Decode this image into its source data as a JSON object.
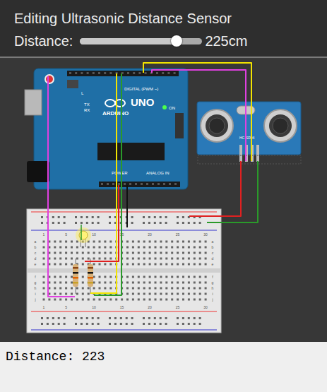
{
  "header": {
    "title": "Editing Ultrasonic Distance Sensor",
    "slider": {
      "label": "Distance:",
      "level": 0.79,
      "reading": "225cm"
    }
  },
  "circuit": {
    "arduino": {
      "brand": "ARDUINO",
      "model": "UNO",
      "digital_label": "DIGITAL (PWM ~)",
      "power_label": "POWER",
      "analog_label": "ANALOG IN",
      "on_label": "ON",
      "tx_label": "TX",
      "rx_label": "RX",
      "l_label": "L"
    },
    "sensor": {
      "label": "HC-SR04"
    },
    "led": {
      "on": true
    },
    "breadboard": {
      "columns": [
        "1",
        "5",
        "10",
        "15",
        "20",
        "25",
        "30"
      ],
      "rows_top": [
        "a",
        "b",
        "c",
        "d",
        "e"
      ],
      "rows_bottom": [
        "f",
        "g",
        "h",
        "i",
        "j"
      ]
    },
    "wires": [
      {
        "name": "trig",
        "color": "#f2e400"
      },
      {
        "name": "echo",
        "color": "#e040e0"
      },
      {
        "name": "sensor-gnd",
        "color": "#2a9a2a"
      },
      {
        "name": "sensor-vcc",
        "color": "#e02020"
      },
      {
        "name": "led-signal",
        "color": "#f2e400"
      },
      {
        "name": "reset-line",
        "color": "#e040e0"
      },
      {
        "name": "board-green",
        "color": "#2a9a2a"
      },
      {
        "name": "board-5v",
        "color": "#e02020"
      },
      {
        "name": "board-gnd",
        "color": "#111111"
      }
    ]
  },
  "serial_monitor": {
    "output": "Distance: 223"
  }
}
